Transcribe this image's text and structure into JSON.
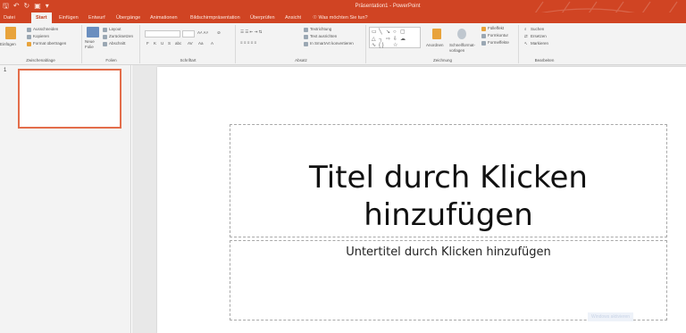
{
  "window": {
    "title": "Präsentation1 - PowerPoint"
  },
  "tabs": [
    "Datei",
    "Start",
    "Einfügen",
    "Entwurf",
    "Übergänge",
    "Animationen",
    "Bildschirmpräsentation",
    "Überprüfen",
    "Ansicht",
    "Was möchten Sie tun?"
  ],
  "ribbon": {
    "clipboard": {
      "paste": "Einfügen",
      "cut": "Ausschneiden",
      "copy": "Kopieren",
      "format_painter": "Format übertragen",
      "label": "Zwischenablage"
    },
    "slides": {
      "new_slide": "Neue Folie",
      "layout": "Layout",
      "reset": "Zurücksetzen",
      "section": "Abschnitt",
      "label": "Folien"
    },
    "font": {
      "label": "Schriftart"
    },
    "paragraph": {
      "text_direction": "Textrichtung",
      "align_text": "Text ausrichten",
      "smartart": "In SmartArt konvertieren",
      "label": "Absatz"
    },
    "drawing": {
      "arrange": "Anordnen",
      "quick_styles": "Schnellformat-vorlagen",
      "fill": "Fülleffekt",
      "outline": "Formkontur",
      "effects": "Formeffekte",
      "label": "Zeichnung"
    },
    "editing": {
      "find": "Suchen",
      "replace": "Ersetzen",
      "select": "Markieren",
      "label": "Bearbeiten"
    }
  },
  "slide_panel": {
    "number": "1"
  },
  "slide": {
    "title_placeholder": "Titel durch Klicken hinzufügen",
    "subtitle_placeholder": "Untertitel durch Klicken hinzufügen"
  },
  "watermark": "Windows aktivieren"
}
